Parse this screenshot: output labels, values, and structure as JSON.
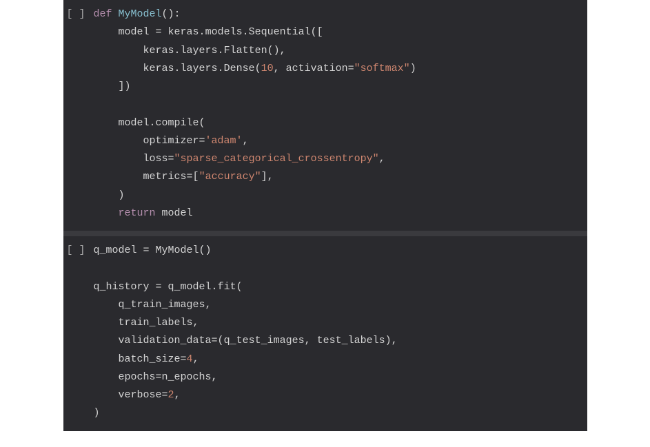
{
  "cells": [
    {
      "prompt": "[ ]",
      "lines": [
        [
          {
            "cls": "tok-keyword",
            "t": "def"
          },
          {
            "cls": "tok-default",
            "t": " "
          },
          {
            "cls": "tok-funcname",
            "t": "MyModel"
          },
          {
            "cls": "tok-paren",
            "t": "():"
          }
        ],
        [
          {
            "cls": "tok-default",
            "t": "    model "
          },
          {
            "cls": "tok-operator",
            "t": "="
          },
          {
            "cls": "tok-default",
            "t": " keras"
          },
          {
            "cls": "tok-dot",
            "t": "."
          },
          {
            "cls": "tok-default",
            "t": "models"
          },
          {
            "cls": "tok-dot",
            "t": "."
          },
          {
            "cls": "tok-default",
            "t": "Sequential"
          },
          {
            "cls": "tok-paren",
            "t": "(["
          }
        ],
        [
          {
            "cls": "tok-default",
            "t": "        keras"
          },
          {
            "cls": "tok-dot",
            "t": "."
          },
          {
            "cls": "tok-default",
            "t": "layers"
          },
          {
            "cls": "tok-dot",
            "t": "."
          },
          {
            "cls": "tok-default",
            "t": "Flatten"
          },
          {
            "cls": "tok-paren",
            "t": "(),"
          }
        ],
        [
          {
            "cls": "tok-default",
            "t": "        keras"
          },
          {
            "cls": "tok-dot",
            "t": "."
          },
          {
            "cls": "tok-default",
            "t": "layers"
          },
          {
            "cls": "tok-dot",
            "t": "."
          },
          {
            "cls": "tok-default",
            "t": "Dense"
          },
          {
            "cls": "tok-paren",
            "t": "("
          },
          {
            "cls": "tok-number",
            "t": "10"
          },
          {
            "cls": "tok-comma",
            "t": ", "
          },
          {
            "cls": "tok-default",
            "t": "activation"
          },
          {
            "cls": "tok-operator",
            "t": "="
          },
          {
            "cls": "tok-string",
            "t": "\"softmax\""
          },
          {
            "cls": "tok-paren",
            "t": ")"
          }
        ],
        [
          {
            "cls": "tok-paren",
            "t": "    ])"
          }
        ],
        [
          {
            "cls": "tok-default",
            "t": ""
          }
        ],
        [
          {
            "cls": "tok-default",
            "t": "    model"
          },
          {
            "cls": "tok-dot",
            "t": "."
          },
          {
            "cls": "tok-default",
            "t": "compile"
          },
          {
            "cls": "tok-paren",
            "t": "("
          }
        ],
        [
          {
            "cls": "tok-default",
            "t": "        optimizer"
          },
          {
            "cls": "tok-operator",
            "t": "="
          },
          {
            "cls": "tok-string",
            "t": "'adam'"
          },
          {
            "cls": "tok-comma",
            "t": ","
          }
        ],
        [
          {
            "cls": "tok-default",
            "t": "        loss"
          },
          {
            "cls": "tok-operator",
            "t": "="
          },
          {
            "cls": "tok-string",
            "t": "\"sparse_categorical_crossentropy\""
          },
          {
            "cls": "tok-comma",
            "t": ","
          }
        ],
        [
          {
            "cls": "tok-default",
            "t": "        metrics"
          },
          {
            "cls": "tok-operator",
            "t": "="
          },
          {
            "cls": "tok-paren",
            "t": "["
          },
          {
            "cls": "tok-string",
            "t": "\"accuracy\""
          },
          {
            "cls": "tok-paren",
            "t": "],"
          }
        ],
        [
          {
            "cls": "tok-paren",
            "t": "    )"
          }
        ],
        [
          {
            "cls": "tok-default",
            "t": "    "
          },
          {
            "cls": "tok-keyword",
            "t": "return"
          },
          {
            "cls": "tok-default",
            "t": " model"
          }
        ]
      ]
    },
    {
      "prompt": "[ ]",
      "lines": [
        [
          {
            "cls": "tok-default",
            "t": "q_model "
          },
          {
            "cls": "tok-operator",
            "t": "="
          },
          {
            "cls": "tok-default",
            "t": " MyModel"
          },
          {
            "cls": "tok-paren",
            "t": "()"
          }
        ],
        [
          {
            "cls": "tok-default",
            "t": ""
          }
        ],
        [
          {
            "cls": "tok-default",
            "t": "q_history "
          },
          {
            "cls": "tok-operator",
            "t": "="
          },
          {
            "cls": "tok-default",
            "t": " q_model"
          },
          {
            "cls": "tok-dot",
            "t": "."
          },
          {
            "cls": "tok-default",
            "t": "fit"
          },
          {
            "cls": "tok-paren",
            "t": "("
          }
        ],
        [
          {
            "cls": "tok-default",
            "t": "    q_train_images"
          },
          {
            "cls": "tok-comma",
            "t": ","
          }
        ],
        [
          {
            "cls": "tok-default",
            "t": "    train_labels"
          },
          {
            "cls": "tok-comma",
            "t": ","
          }
        ],
        [
          {
            "cls": "tok-default",
            "t": "    validation_data"
          },
          {
            "cls": "tok-operator",
            "t": "="
          },
          {
            "cls": "tok-paren",
            "t": "("
          },
          {
            "cls": "tok-default",
            "t": "q_test_images"
          },
          {
            "cls": "tok-comma",
            "t": ", "
          },
          {
            "cls": "tok-default",
            "t": "test_labels"
          },
          {
            "cls": "tok-paren",
            "t": "),"
          }
        ],
        [
          {
            "cls": "tok-default",
            "t": "    batch_size"
          },
          {
            "cls": "tok-operator",
            "t": "="
          },
          {
            "cls": "tok-number",
            "t": "4"
          },
          {
            "cls": "tok-comma",
            "t": ","
          }
        ],
        [
          {
            "cls": "tok-default",
            "t": "    epochs"
          },
          {
            "cls": "tok-operator",
            "t": "="
          },
          {
            "cls": "tok-default",
            "t": "n_epochs"
          },
          {
            "cls": "tok-comma",
            "t": ","
          }
        ],
        [
          {
            "cls": "tok-default",
            "t": "    verbose"
          },
          {
            "cls": "tok-operator",
            "t": "="
          },
          {
            "cls": "tok-number",
            "t": "2"
          },
          {
            "cls": "tok-comma",
            "t": ","
          }
        ],
        [
          {
            "cls": "tok-paren",
            "t": ")"
          }
        ]
      ]
    }
  ],
  "colors": {
    "cellBg": "#2a2a2e",
    "separator": "#3a3a3e",
    "gutterText": "#a8a8a8"
  }
}
